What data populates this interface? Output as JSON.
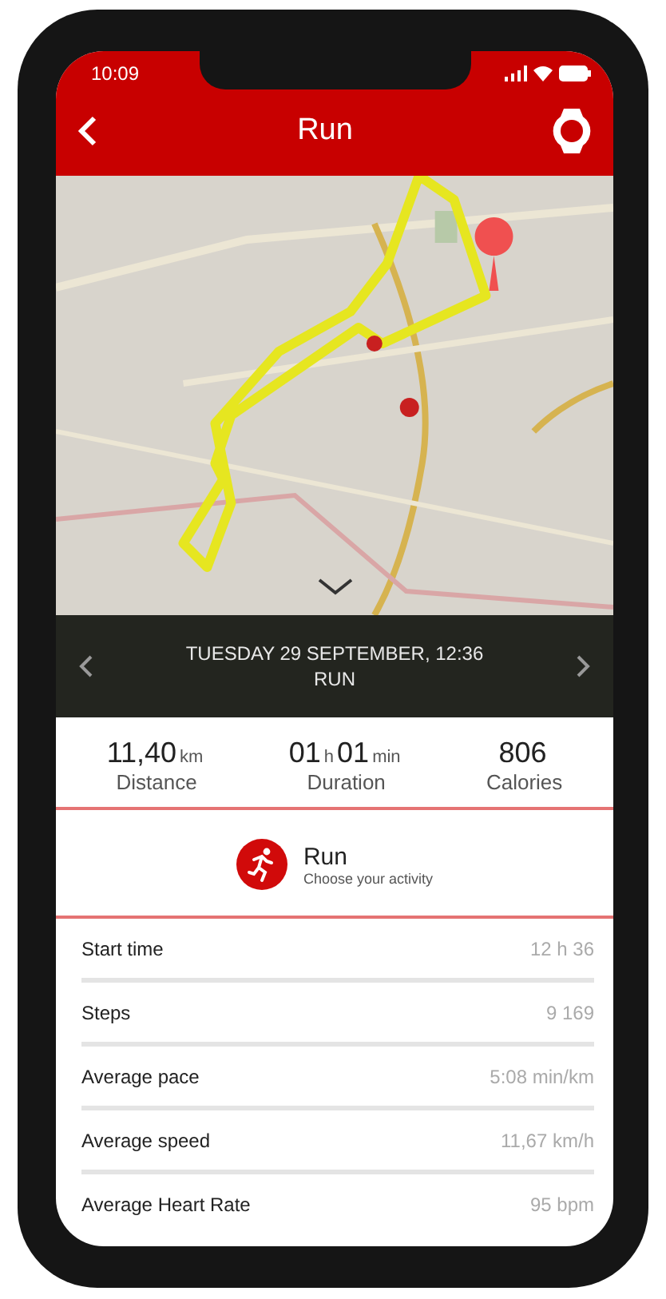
{
  "status_bar": {
    "time": "10:09"
  },
  "header": {
    "title": "Run"
  },
  "activity_bar": {
    "date": "TUESDAY 29 SEPTEMBER, 12:36",
    "type": "RUN"
  },
  "stats": [
    {
      "parts": [
        {
          "text": "11,40",
          "kind": "number"
        },
        {
          "text": "km",
          "kind": "unit"
        }
      ],
      "label": "Distance"
    },
    {
      "parts": [
        {
          "text": "01",
          "kind": "number"
        },
        {
          "text": "h",
          "kind": "unit"
        },
        {
          "text": "01",
          "kind": "number"
        },
        {
          "text": "min",
          "kind": "unit"
        }
      ],
      "label": "Duration"
    },
    {
      "parts": [
        {
          "text": "806",
          "kind": "number"
        }
      ],
      "label": "Calories"
    }
  ],
  "activity": {
    "name": "Run",
    "hint": "Choose your activity"
  },
  "details": [
    {
      "label": "Start time",
      "value": "12 h 36"
    },
    {
      "label": "Steps",
      "value": "9 169"
    },
    {
      "label": "Average pace",
      "value": "5:08 min/km"
    },
    {
      "label": "Average speed",
      "value": "11,67 km/h"
    },
    {
      "label": "Average Heart Rate",
      "value": "95 bpm"
    }
  ]
}
